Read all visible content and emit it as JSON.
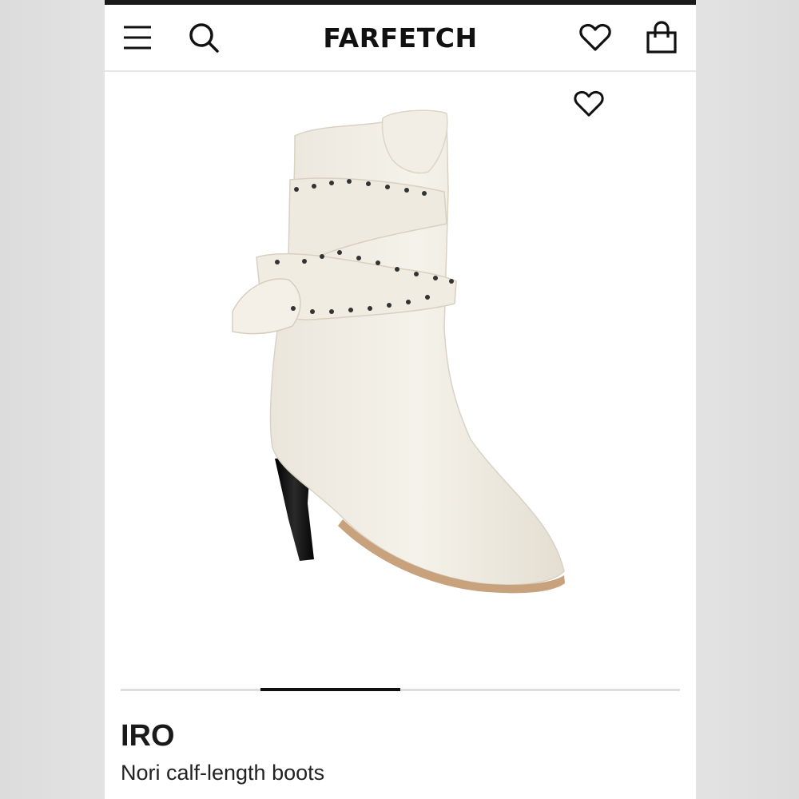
{
  "header": {
    "logo": "FARFETCH",
    "menu_icon": "hamburger-menu-icon",
    "search_icon": "search-icon",
    "wishlist_icon": "heart-icon",
    "bag_icon": "shopping-bag-icon"
  },
  "product": {
    "brand": "IRO",
    "name": "Nori calf-length boots",
    "image_description_icon": "boot-image",
    "wishlist_icon": "heart-icon",
    "color": "#f3efe6"
  },
  "gallery": {
    "current_index": 2,
    "total": 4
  },
  "colors": {
    "text": "#111111",
    "divider": "#e6e6e6",
    "pager_track": "#dedede",
    "pager_active": "#111111"
  }
}
